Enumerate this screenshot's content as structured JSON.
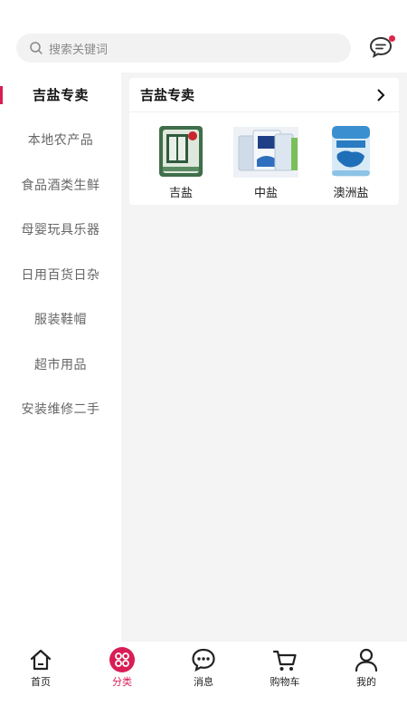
{
  "search": {
    "placeholder": "搜索关键词",
    "icon": "search-icon"
  },
  "header": {
    "message_icon": "chat-bubble-icon",
    "accent_color": "#d81e55"
  },
  "sidebar": {
    "items": [
      {
        "label": "吉盐专卖",
        "active": true
      },
      {
        "label": "本地农产品"
      },
      {
        "label": "食品酒类生鲜"
      },
      {
        "label": "母婴玩具乐器"
      },
      {
        "label": "日用百货日杂"
      },
      {
        "label": "服装鞋帽"
      },
      {
        "label": "超市用品"
      },
      {
        "label": "安装维修二手"
      }
    ]
  },
  "category": {
    "title": "吉盐专卖",
    "products": [
      {
        "name": "吉盐",
        "icon": "salt-bag-green"
      },
      {
        "name": "中盐",
        "icon": "salt-pack-blue"
      },
      {
        "name": "澳洲盐",
        "icon": "salt-bag-blue"
      }
    ]
  },
  "tabbar": {
    "tabs": [
      {
        "label": "首页",
        "icon": "home-icon"
      },
      {
        "label": "分类",
        "icon": "category-icon",
        "active": true
      },
      {
        "label": "消息",
        "icon": "message-icon"
      },
      {
        "label": "购物车",
        "icon": "cart-icon"
      },
      {
        "label": "我的",
        "icon": "profile-icon"
      }
    ]
  }
}
